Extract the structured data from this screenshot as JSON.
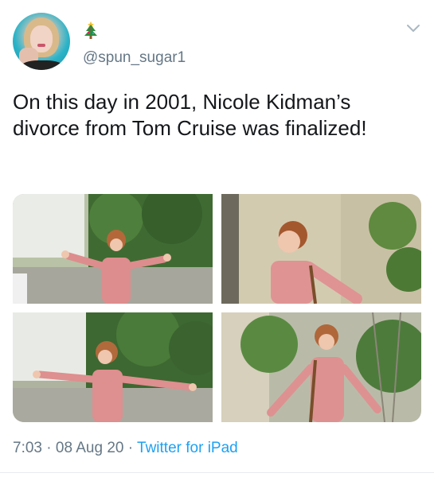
{
  "user": {
    "handle": "@spun_sugar1",
    "name_icon": "christmas-tree-icon"
  },
  "tweet": {
    "text": "On this day in 2001, Nicole Kidman’s divorce from Tom Cruise was finalized!",
    "time": "7:03",
    "date": "08 Aug 20",
    "separator": " · ",
    "source": "Twitter for iPad"
  },
  "media": {
    "count": 4,
    "photos": [
      "photo-1",
      "photo-2",
      "photo-3",
      "photo-4"
    ]
  },
  "icons": {
    "menu": "chevron-down-icon",
    "avatar": "avatar"
  },
  "colors": {
    "text": "#14171a",
    "secondary": "#657786",
    "link": "#1da1f2"
  }
}
